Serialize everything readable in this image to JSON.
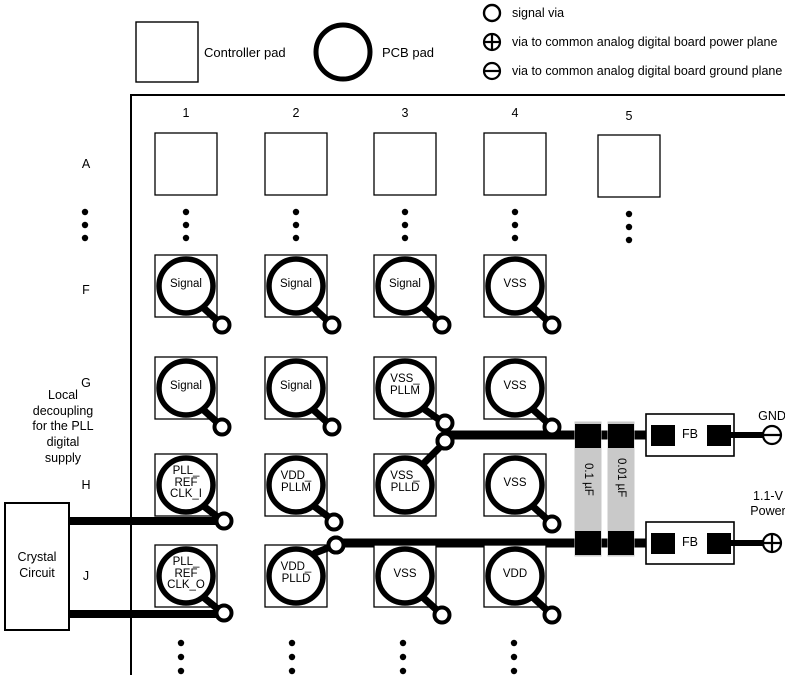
{
  "legend": {
    "items": [
      {
        "icon": "signal-via-icon",
        "label": "signal via"
      },
      {
        "icon": "power-via-icon",
        "label": "via to common analog digital board power plane"
      },
      {
        "icon": "ground-via-icon",
        "label": "via to common analog digital board ground plane"
      }
    ]
  },
  "key": {
    "controller_pad": "Controller pad",
    "pcb_pad": "PCB pad"
  },
  "grid": {
    "columns": [
      "1",
      "2",
      "3",
      "4",
      "5"
    ],
    "rows": [
      "A",
      "F",
      "G",
      "H",
      "J"
    ],
    "ellipsis": "•"
  },
  "pads": {
    "row_A": [
      "",
      "",
      "",
      "",
      ""
    ],
    "row_F": [
      "Signal",
      "Signal",
      "Signal",
      "VSS"
    ],
    "row_G": [
      "Signal",
      "Signal",
      "VSS_\nPLLM",
      "VSS"
    ],
    "row_H": [
      "PLL_\nREF\nCLK_I",
      "VDD_\nPLLM",
      "VSS_\nPLLD",
      "VSS"
    ],
    "row_J": [
      "PLL_\nREF\nCLK_O",
      "VDD_\nPLLD",
      "VSS",
      "VDD"
    ]
  },
  "components": {
    "cap1": "0.1 µF",
    "cap2": "0.01 µF",
    "fb_top": "FB",
    "fb_bottom": "FB",
    "net_gnd": "GND",
    "net_power": "1.1-V\nPower"
  },
  "annotations": {
    "local_decoupling": "Local\ndecoupling\nfor the PLL\ndigital\nsupply",
    "crystal_circuit": "Crystal\nCircuit"
  },
  "colors": {
    "ink": "#000000",
    "background": "#ffffff",
    "capacitor_body": "#c9c9c9",
    "thin_line": "#000000"
  }
}
